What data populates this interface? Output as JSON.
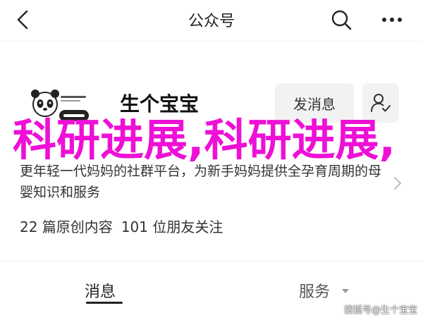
{
  "header": {
    "title": "公众号",
    "back_icon": "chevron-left-icon",
    "search_icon": "search-icon",
    "more_icon": "more-horizontal-icon"
  },
  "account": {
    "name": "生个宝宝",
    "send_message_label": "发消息",
    "follow_icon": "user-follow-icon",
    "description": "更年轻一代妈妈的社群平台，为新手妈妈提供全孕育周期的母婴知识和服务",
    "stats": {
      "articles": "22 篇原创内容",
      "friends": "101 位朋友关注"
    }
  },
  "tabs": [
    {
      "label": "消息",
      "active": true
    },
    {
      "label": "服务",
      "active": false
    }
  ],
  "overlay": {
    "text": "科研进展,科研进展,",
    "color": "#ee10d6"
  },
  "watermark": "搜狐号@生个宝宝",
  "colors": {
    "button_bg": "#f2f2f2",
    "overlay": "#ee10d6"
  }
}
